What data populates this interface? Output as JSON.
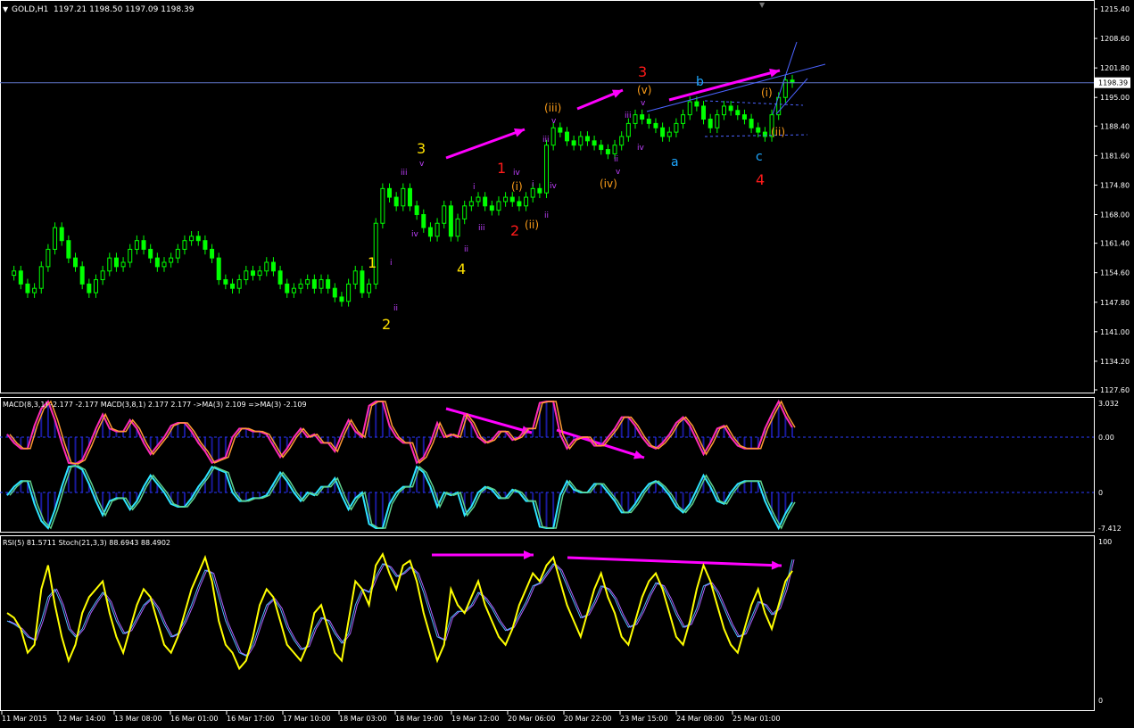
{
  "window": {
    "symbol_label": "GOLD,H1",
    "ohlc_label": "1197.21 1198.50 1197.09 1198.39"
  },
  "colors": {
    "background": "#000000",
    "grid_frame": "#ffffff",
    "candles": "#00ff00",
    "price_line": "#5f74c8",
    "arrow": "#ff00ff",
    "label_yellow": "#ffe100",
    "label_red": "#ff1a1a",
    "label_cyan": "#1ea7ff",
    "label_orange": "#ff9f1a",
    "label_violet": "#c040ff",
    "trendline": "#4b63ff",
    "macd_magenta": "#ff2bb5",
    "macd_orange": "#ff9a33",
    "macd_cyan": "#2ee6ff",
    "macd_green": "#5fd08a",
    "macd_hist": "#2a2aff",
    "rsi_yellow": "#ffff00",
    "stoch_blue": "#4fb8ff",
    "stoch_purple": "#b060ff",
    "zero_line": "#2b3dff"
  },
  "chart_data": [
    {
      "type": "line",
      "title": "GOLD,H1",
      "yaxis_ticks": [
        "1215.40",
        "1208.60",
        "1201.80",
        "1195.00",
        "1188.40",
        "1181.60",
        "1174.80",
        "1168.00",
        "1161.40",
        "1154.60",
        "1147.80",
        "1141.00",
        "1134.20",
        "1127.60"
      ],
      "ylim": [
        1127.6,
        1215.4
      ],
      "current_price_label": "1198.39",
      "xaxis_ticks": [
        "11 Mar 2015",
        "12 Mar 14:00",
        "13 Mar 08:00",
        "16 Mar 01:00",
        "16 Mar 17:00",
        "17 Mar 10:00",
        "18 Mar 03:00",
        "18 Mar 19:00",
        "19 Mar 12:00",
        "20 Mar 06:00",
        "20 Mar 22:00",
        "23 Mar 15:00",
        "24 Mar 08:00",
        "25 Mar 01:00"
      ],
      "series": [
        {
          "values": [
            1154,
            1155,
            1152,
            1150,
            1151,
            1156,
            1160,
            1165,
            1162,
            1158,
            1156,
            1152,
            1150,
            1153,
            1155,
            1158,
            1156,
            1157,
            1160,
            1162,
            1160,
            1158,
            1156,
            1157,
            1158,
            1160,
            1162,
            1163,
            1162,
            1160,
            1158,
            1153,
            1152,
            1151,
            1153,
            1155,
            1154,
            1155,
            1157,
            1155,
            1152,
            1150,
            1151,
            1152,
            1153,
            1151,
            1153,
            1151,
            1149,
            1148,
            1152,
            1155,
            1150,
            1152,
            1166,
            1174,
            1172,
            1170,
            1174,
            1170,
            1168,
            1165,
            1163,
            1166,
            1170,
            1163,
            1167,
            1170,
            1171,
            1172,
            1170,
            1169,
            1171,
            1172,
            1171,
            1170,
            1172,
            1174,
            1173,
            1184,
            1188,
            1187,
            1185,
            1184,
            1186,
            1185,
            1184,
            1183,
            1182,
            1184,
            1186,
            1189,
            1191,
            1190,
            1189,
            1188,
            1186,
            1187,
            1189,
            1191,
            1194,
            1193,
            1190,
            1188,
            1191,
            1193,
            1192,
            1191,
            1190,
            1188,
            1187,
            1186,
            1191,
            1195,
            1199,
            1198.4
          ]
        }
      ],
      "wave_labels": [
        {
          "text": "1",
          "color": "yellow"
        },
        {
          "text": "2",
          "color": "yellow"
        },
        {
          "text": "3",
          "color": "yellow"
        },
        {
          "text": "4",
          "color": "yellow"
        },
        {
          "text": "1",
          "color": "red"
        },
        {
          "text": "2",
          "color": "red"
        },
        {
          "text": "3",
          "color": "red"
        },
        {
          "text": "4",
          "color": "red"
        },
        {
          "text": "a",
          "color": "cyan"
        },
        {
          "text": "b",
          "color": "cyan"
        },
        {
          "text": "c",
          "color": "cyan"
        },
        {
          "text": "(i)",
          "color": "orange"
        },
        {
          "text": "(ii)",
          "color": "orange"
        },
        {
          "text": "(iii)",
          "color": "orange"
        },
        {
          "text": "(iv)",
          "color": "orange"
        },
        {
          "text": "(v)",
          "color": "orange"
        },
        {
          "text": "(i)",
          "color": "orange"
        },
        {
          "text": "(ii)",
          "color": "orange"
        },
        {
          "text": "i",
          "color": "violet"
        },
        {
          "text": "ii",
          "color": "violet"
        },
        {
          "text": "iii",
          "color": "violet"
        },
        {
          "text": "iv",
          "color": "violet"
        },
        {
          "text": "v",
          "color": "violet"
        },
        {
          "text": "i",
          "color": "violet"
        },
        {
          "text": "ii",
          "color": "violet"
        },
        {
          "text": "iii",
          "color": "violet"
        },
        {
          "text": "iv",
          "color": "violet"
        },
        {
          "text": "v",
          "color": "violet"
        },
        {
          "text": "i",
          "color": "violet"
        },
        {
          "text": "ii",
          "color": "violet"
        },
        {
          "text": "iii",
          "color": "violet"
        },
        {
          "text": "iv",
          "color": "violet"
        },
        {
          "text": "v",
          "color": "violet"
        },
        {
          "text": "iii",
          "color": "violet"
        },
        {
          "text": "iv",
          "color": "violet"
        },
        {
          "text": "v",
          "color": "violet"
        },
        {
          "text": "ii",
          "color": "violet"
        }
      ]
    },
    {
      "type": "line",
      "title": "MACD(8,3,1) -2.177 -2.177  MACD(3,8,1) 2.177 2.177  ->MA(3) 2.109  =>MA(3) -2.109",
      "yaxis_ticks": [
        "3.032",
        "0.00",
        "0",
        "-7.412"
      ],
      "ylim": [
        -7.412,
        3.032
      ]
    },
    {
      "type": "line",
      "title": "RSI(5) 81.5711  Stoch(21,3,3) 88.6943 88.4902",
      "yaxis_ticks": [
        "100",
        "0"
      ],
      "ylim": [
        0,
        100
      ],
      "series": [
        {
          "name": "RSI(5)",
          "values": [
            55,
            52,
            45,
            30,
            35,
            70,
            85,
            60,
            40,
            25,
            35,
            55,
            65,
            70,
            75,
            55,
            40,
            30,
            45,
            60,
            70,
            65,
            50,
            35,
            30,
            40,
            55,
            70,
            80,
            90,
            75,
            50,
            35,
            30,
            20,
            25,
            40,
            60,
            70,
            65,
            50,
            35,
            30,
            25,
            35,
            55,
            60,
            45,
            30,
            25,
            50,
            75,
            70,
            60,
            85,
            92,
            80,
            70,
            85,
            88,
            75,
            55,
            40,
            25,
            35,
            70,
            60,
            55,
            65,
            75,
            60,
            50,
            40,
            35,
            45,
            60,
            70,
            80,
            75,
            85,
            90,
            75,
            60,
            50,
            40,
            55,
            70,
            80,
            65,
            55,
            40,
            35,
            50,
            65,
            75,
            80,
            70,
            55,
            40,
            35,
            50,
            70,
            85,
            75,
            60,
            45,
            35,
            30,
            45,
            60,
            70,
            55,
            45,
            60,
            75,
            81.6
          ]
        },
        {
          "name": "Stoch(21,3,3)",
          "values": [
            50,
            48,
            45,
            40,
            38,
            50,
            65,
            70,
            60,
            45,
            40,
            45,
            55,
            62,
            68,
            62,
            50,
            42,
            44,
            52,
            60,
            64,
            58,
            48,
            40,
            42,
            50,
            60,
            72,
            82,
            80,
            65,
            50,
            40,
            30,
            28,
            35,
            48,
            60,
            64,
            58,
            46,
            38,
            32,
            34,
            45,
            52,
            50,
            42,
            36,
            42,
            60,
            70,
            68,
            78,
            86,
            84,
            78,
            80,
            84,
            80,
            68,
            54,
            40,
            38,
            52,
            56,
            56,
            60,
            68,
            64,
            58,
            50,
            44,
            46,
            54,
            62,
            72,
            74,
            80,
            86,
            82,
            72,
            62,
            52,
            54,
            62,
            72,
            70,
            64,
            54,
            46,
            48,
            56,
            66,
            74,
            72,
            64,
            54,
            46,
            48,
            58,
            72,
            74,
            68,
            58,
            48,
            40,
            42,
            52,
            62,
            60,
            54,
            58,
            70,
            88.7
          ]
        }
      ]
    }
  ],
  "indicators": {
    "macd_levels": [
      "0.00",
      "0"
    ],
    "zero_level_label": "0.00"
  }
}
